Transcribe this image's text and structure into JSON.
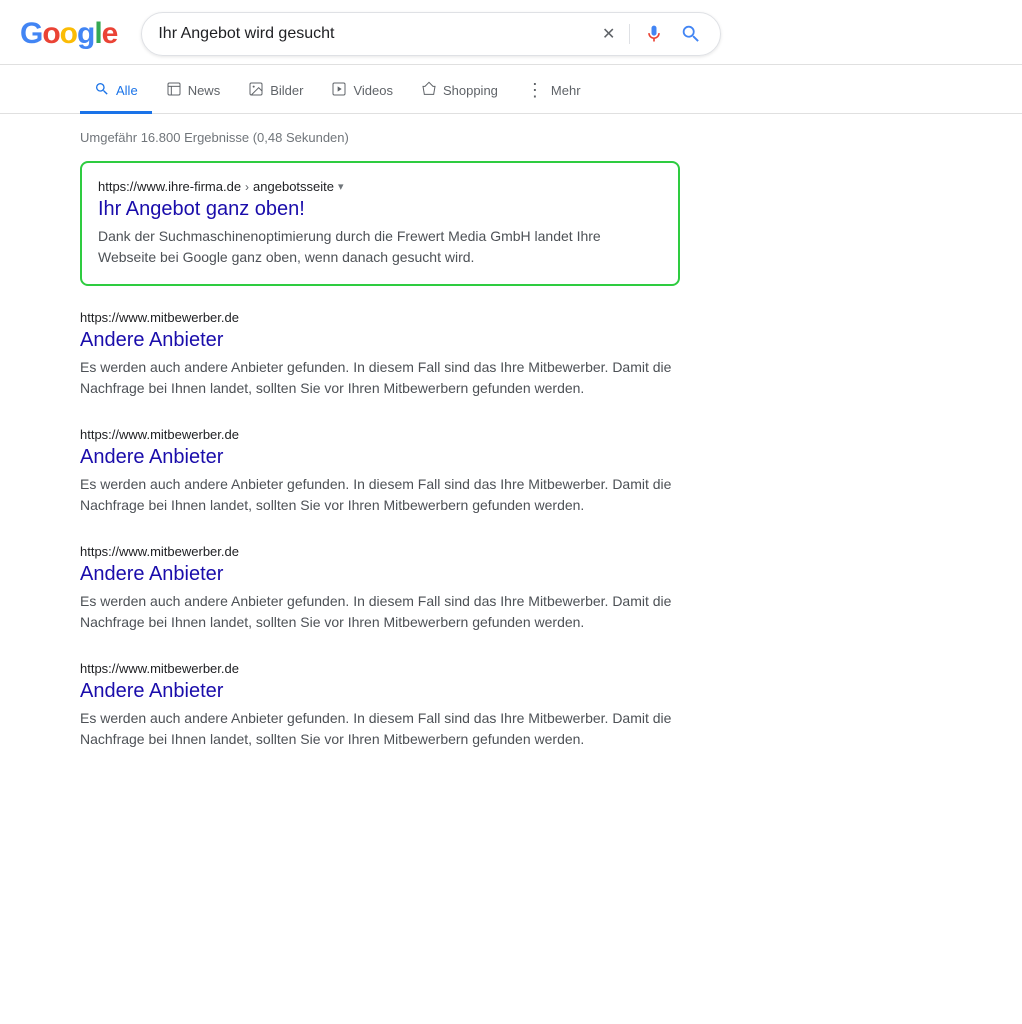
{
  "header": {
    "logo_letters": [
      {
        "char": "G",
        "color_class": "g-blue"
      },
      {
        "char": "o",
        "color_class": "g-red"
      },
      {
        "char": "o",
        "color_class": "g-yellow"
      },
      {
        "char": "g",
        "color_class": "g-blue"
      },
      {
        "char": "l",
        "color_class": "g-green"
      },
      {
        "char": "e",
        "color_class": "g-red"
      }
    ],
    "search_query": "Ihr Angebot wird gesucht",
    "clear_button_label": "✕",
    "mic_icon": "🎤",
    "search_icon": "🔍"
  },
  "nav": {
    "tabs": [
      {
        "id": "alle",
        "label": "Alle",
        "icon": "🔍",
        "active": true
      },
      {
        "id": "news",
        "label": "News",
        "icon": "📄"
      },
      {
        "id": "bilder",
        "label": "Bilder",
        "icon": "🖼"
      },
      {
        "id": "videos",
        "label": "Videos",
        "icon": "▶"
      },
      {
        "id": "shopping",
        "label": "Shopping",
        "icon": "◇"
      },
      {
        "id": "mehr",
        "label": "Mehr",
        "icon": "⋮"
      }
    ]
  },
  "results": {
    "count_text": "Umgefähr 16.800 Ergebnisse (0,48 Sekunden)",
    "featured": {
      "url": "https://www.ihre-firma.de",
      "url_path": "angebotsseite",
      "title": "Ihr Angebot ganz oben!",
      "description": "Dank der Suchmaschinenoptimierung durch die Frewert Media GmbH landet Ihre Webseite bei Google ganz oben, wenn danach gesucht wird."
    },
    "items": [
      {
        "url": "https://www.mitbewerber.de",
        "title": "Andere Anbieter",
        "description": "Es werden auch andere Anbieter gefunden. In diesem Fall sind das Ihre Mitbewerber. Damit die Nachfrage bei Ihnen landet, sollten Sie vor Ihren Mitbewerbern gefunden werden."
      },
      {
        "url": "https://www.mitbewerber.de",
        "title": "Andere Anbieter",
        "description": "Es werden auch andere Anbieter gefunden. In diesem Fall sind das Ihre Mitbewerber. Damit die Nachfrage bei Ihnen landet, sollten Sie vor Ihren Mitbewerbern gefunden werden."
      },
      {
        "url": "https://www.mitbewerber.de",
        "title": "Andere Anbieter",
        "description": "Es werden auch andere Anbieter gefunden. In diesem Fall sind das Ihre Mitbewerber. Damit die Nachfrage bei Ihnen landet, sollten Sie vor Ihren Mitbewerbern gefunden werden."
      },
      {
        "url": "https://www.mitbewerber.de",
        "title": "Andere Anbieter",
        "description": "Es werden auch andere Anbieter gefunden. In diesem Fall sind das Ihre Mitbewerber. Damit die Nachfrage bei Ihnen landet, sollten Sie vor Ihren Mitbewerbern gefunden werden."
      }
    ]
  }
}
